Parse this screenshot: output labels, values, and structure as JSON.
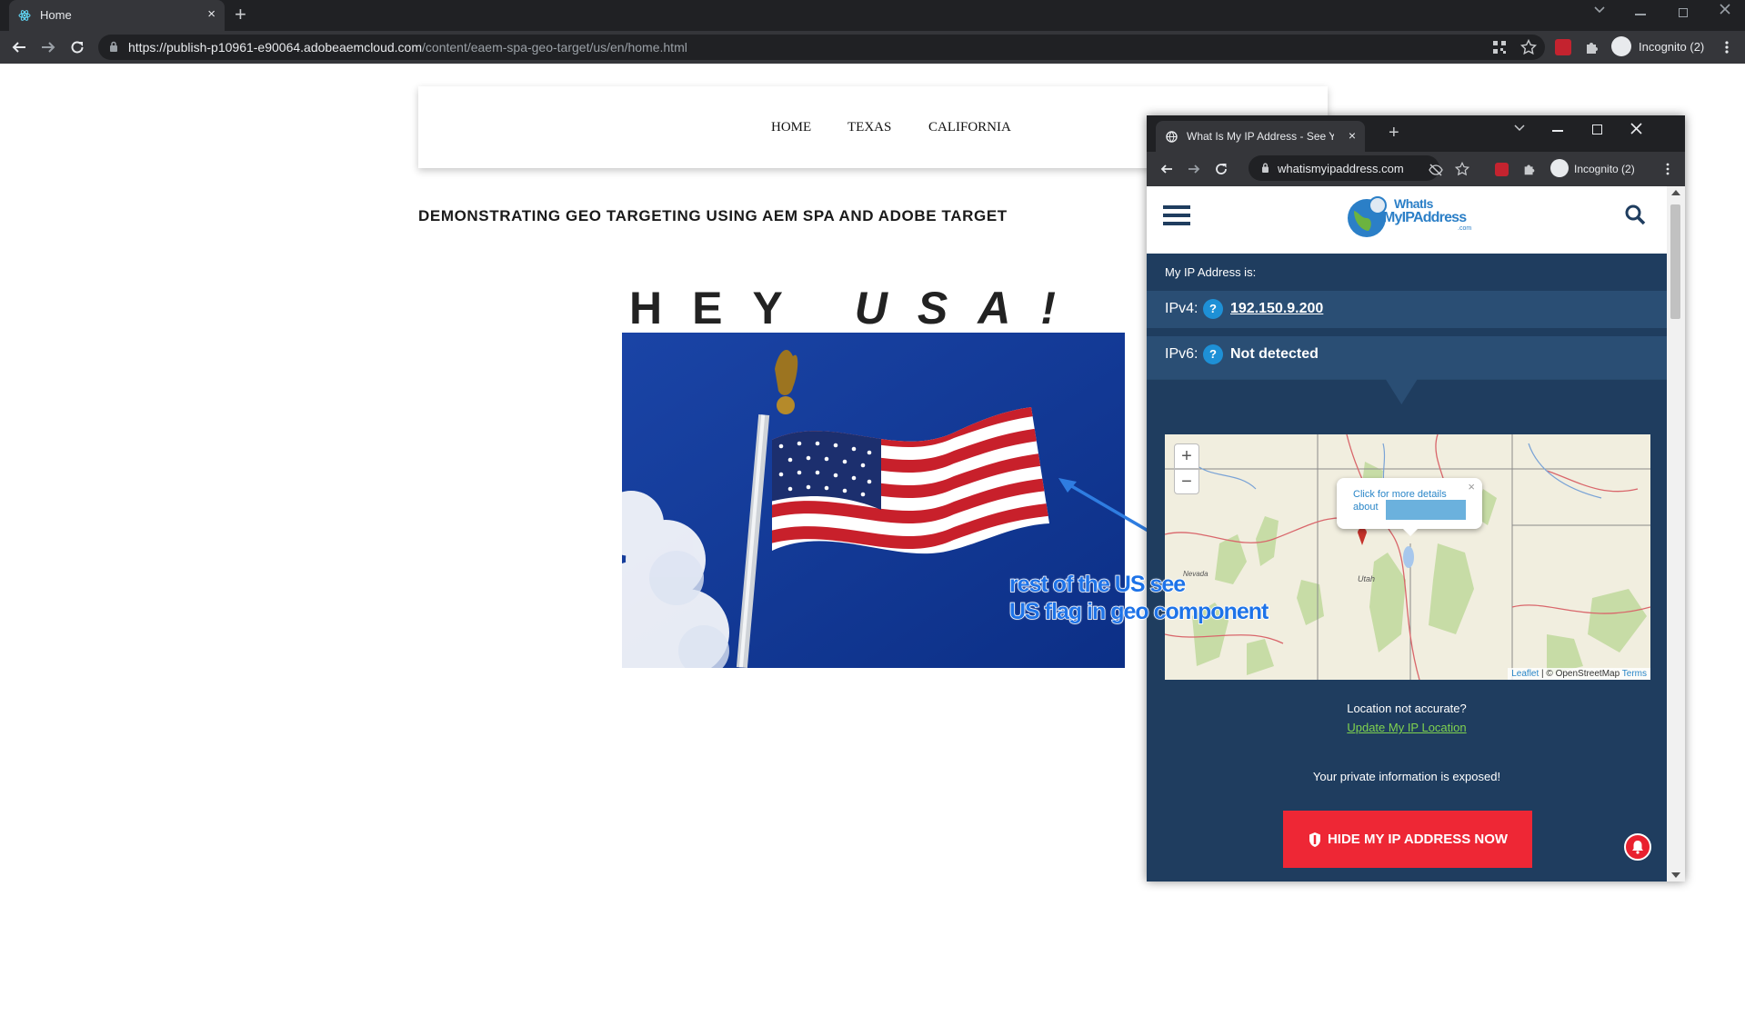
{
  "main_browser": {
    "tab": {
      "title": "Home",
      "close": "×"
    },
    "new_tab": "+",
    "url_host": "https://publish-p10961-e90064.adobeaemcloud.com",
    "url_path": "/content/eaem-spa-geo-target/us/en/home.html",
    "incognito_label": "Incognito (2)"
  },
  "page": {
    "nav": {
      "items": [
        "HOME",
        "TEXAS",
        "CALIFORNIA"
      ]
    },
    "heading": "DEMONSTRATING GEO TARGETING USING AEM SPA AND ADOBE TARGET",
    "banner_plain": "HEY ",
    "banner_italic": "USA!",
    "annotation_line1": "rest of the US see",
    "annotation_line2": "US flag in geo component"
  },
  "popup_browser": {
    "tab": {
      "title": "What Is My IP Address - See Your",
      "close": "×"
    },
    "new_tab": "+",
    "url": "whatismyipaddress.com",
    "incognito_label": "Incognito (2)",
    "site": {
      "logo_line1": "WhatIs",
      "logo_line2": "MyIPAddress",
      "logo_line3": ".com",
      "ip_heading": "My IP Address is:",
      "ipv4_label": "IPv4:",
      "ipv4_value": "192.150.9.200",
      "ipv6_label": "IPv6:",
      "ipv6_value": "Not detected",
      "help_glyph": "?",
      "map": {
        "zoom_in": "+",
        "zoom_out": "−",
        "popup_line1": "Click for more details",
        "popup_line2": "about",
        "popup_close": "×",
        "label_utah": "Utah",
        "label_nevada": "Nevada",
        "attribution_leaflet": "Leaflet",
        "attribution_osm": " | © OpenStreetMap ",
        "attribution_terms": "Terms"
      },
      "location_question": "Location not accurate?",
      "update_link": "Update My IP Location",
      "exposed_text": "Your private information is exposed!",
      "hide_button": "HIDE MY IP ADDRESS NOW"
    }
  },
  "colors": {
    "chrome_dark": "#202124",
    "chrome_toolbar": "#35363a",
    "site_blue": "#1f3d5f",
    "ip_row": "#2a4e74",
    "accent_red": "#ee2735",
    "link_green": "#7fd34f",
    "annotation_blue": "#1e73e8"
  }
}
